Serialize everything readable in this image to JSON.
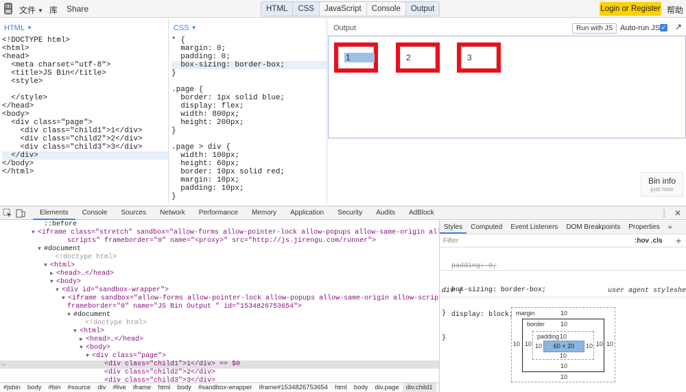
{
  "topbar": {
    "menu_file": "文件",
    "menu_library": "库",
    "menu_share": "Share",
    "tabs": [
      {
        "label": "HTML",
        "active": true
      },
      {
        "label": "CSS",
        "active": true
      },
      {
        "label": "JavaScript",
        "active": false
      },
      {
        "label": "Console",
        "active": false
      },
      {
        "label": "Output",
        "active": true
      }
    ],
    "login_label": "Login or Register",
    "help_label": "帮助",
    "accent_color": "#fbd300"
  },
  "html_panel": {
    "label": "HTML",
    "lines": [
      "<!DOCTYPE html>",
      "<html>",
      "<head>",
      "  <meta charset=\"utf-8\">",
      "  <title>JS Bin</title>",
      "  <style>",
      "",
      "  </style>",
      "</head>",
      "<body>",
      "  <div class=\"page\">",
      "    <div class=\"child1\">1</div>",
      "    <div class=\"child2\">2</div>",
      "    <div class=\"child3\">3</div>",
      "  </div>",
      "</body>",
      "</html>"
    ]
  },
  "css_panel": {
    "label": "CSS",
    "lines": [
      "* {",
      "  margin: 0;",
      "  padding: 0;",
      "  box-sizing: border-box;",
      "}",
      "",
      ".page {",
      "  border: 1px solid blue;",
      "  display: flex;",
      "  width: 800px;",
      "  height: 200px;",
      "}",
      "",
      ".page > div {",
      "  width: 100px;",
      "  height: 60px;",
      "  border: 10px solid red;",
      "  margin: 10px;",
      "  padding: 10px;",
      "}"
    ]
  },
  "output_panel": {
    "label": "Output",
    "run_label": "Run with JS",
    "autorun_label": "Auto-run JS",
    "children": [
      "1",
      "2",
      "3"
    ],
    "child_border_color": "#e8101c",
    "page_border_color": "#aab0e6",
    "bin_info_title": "Bin info",
    "bin_info_sub": "just now"
  },
  "devtools": {
    "tabs": [
      "Elements",
      "Console",
      "Sources",
      "Network",
      "Performance",
      "Memory",
      "Application",
      "Security",
      "Audits",
      "AdBlock"
    ],
    "elements": [
      "::before",
      "<iframe class=\"stretch\" sandbox=\"allow-forms allow-pointer-lock allow-popups allow-same-origin allow-",
      "scripts\" frameborder=\"0\" name=\"<proxy>\" src=\"http://js.jirengu.com/runner\">",
      "#document",
      "<!doctype html>",
      "<html>",
      "<head>…</head>",
      "<body>",
      "<div id=\"sandbox-wrapper\">",
      "<iframe sandbox=\"allow-forms allow-pointer-lock allow-popups allow-same-origin allow-scripts\"",
      "frameborder=\"0\" name=\"JS Bin Output \" id=\"1534826753654\">",
      "#document",
      "<!doctype html>",
      "<html>",
      "<head>…</head>",
      "<body>",
      "<div class=\"page\">",
      "<div class=\"child1\">1</div> == $0",
      "<div class=\"child2\">2</div>",
      "<div class=\"child3\">3</div>"
    ],
    "breadcrumbs": [
      "#jsbin",
      "body",
      "#bin",
      "#source",
      "div",
      "#live",
      "iframe",
      "html",
      "body",
      "#sandbox-wrapper",
      "iframe#1534826753654",
      "html",
      "body",
      "div.page",
      "div.child1"
    ],
    "styles_tabs": [
      "Styles",
      "Computed",
      "Event Listeners",
      "DOM Breakpoints",
      "Properties",
      "»"
    ],
    "filter_placeholder": "Filter",
    "hov_cls": ":hov .cls",
    "rule1_line1": "padding: 0;",
    "rule1_line2": "box-sizing: border-box;",
    "rule1_close": "}",
    "rule2_selector": "div {",
    "rule2_source": "user agent stylesheet",
    "rule2_prop": "display: block;",
    "rule2_close": "}",
    "box_model": {
      "margin_label": "margin",
      "border_label": "border",
      "padding_label": "padding",
      "margin": "10",
      "border": "10",
      "padding": "10",
      "content": "60 × 20"
    }
  }
}
